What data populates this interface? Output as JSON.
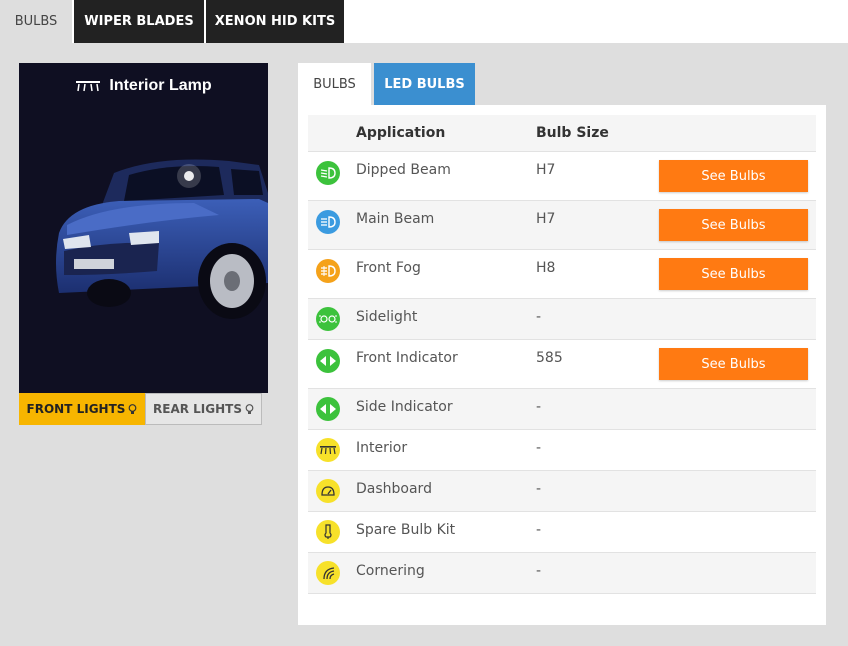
{
  "top_tabs": [
    "BULBS",
    "WIPER BLADES",
    "XENON HID KITS"
  ],
  "car_panel": {
    "title": "Interior Lamp",
    "front_lights": "FRONT LIGHTS",
    "rear_lights": "REAR LIGHTS"
  },
  "inner_tabs": [
    "BULBS",
    "LED BULBS"
  ],
  "table": {
    "headers": {
      "application": "Application",
      "bulb_size": "Bulb Size"
    },
    "rows": [
      {
        "application": "Dipped Beam",
        "bulb_size": "H7",
        "button": "See Bulbs",
        "icon": "dipped-beam-icon",
        "icon_color": "#3cc23c"
      },
      {
        "application": "Main Beam",
        "bulb_size": "H7",
        "button": "See Bulbs",
        "icon": "main-beam-icon",
        "icon_color": "#3b9be0"
      },
      {
        "application": "Front Fog",
        "bulb_size": "H8",
        "button": "See Bulbs",
        "icon": "fog-light-icon",
        "icon_color": "#f5a21a"
      },
      {
        "application": "Sidelight",
        "bulb_size": "-",
        "button": "",
        "icon": "sidelight-icon",
        "icon_color": "#3cc23c"
      },
      {
        "application": "Front Indicator",
        "bulb_size": "585",
        "button": "See Bulbs",
        "icon": "indicator-icon",
        "icon_color": "#3cc23c"
      },
      {
        "application": "Side Indicator",
        "bulb_size": "-",
        "button": "",
        "icon": "indicator-icon",
        "icon_color": "#3cc23c"
      },
      {
        "application": "Interior",
        "bulb_size": "-",
        "button": "",
        "icon": "interior-lamp-icon",
        "icon_color": "#f7e12a"
      },
      {
        "application": "Dashboard",
        "bulb_size": "-",
        "button": "",
        "icon": "dashboard-icon",
        "icon_color": "#f7e12a"
      },
      {
        "application": "Spare Bulb Kit",
        "bulb_size": "-",
        "button": "",
        "icon": "spare-bulb-icon",
        "icon_color": "#f7e12a"
      },
      {
        "application": "Cornering",
        "bulb_size": "-",
        "button": "",
        "icon": "cornering-icon",
        "icon_color": "#f7e12a"
      }
    ]
  },
  "colors": {
    "accent_orange": "#ff7a12",
    "accent_blue": "#3b8fd0",
    "accent_yellow": "#f7b500",
    "panel_dark": "#0f0f22"
  }
}
